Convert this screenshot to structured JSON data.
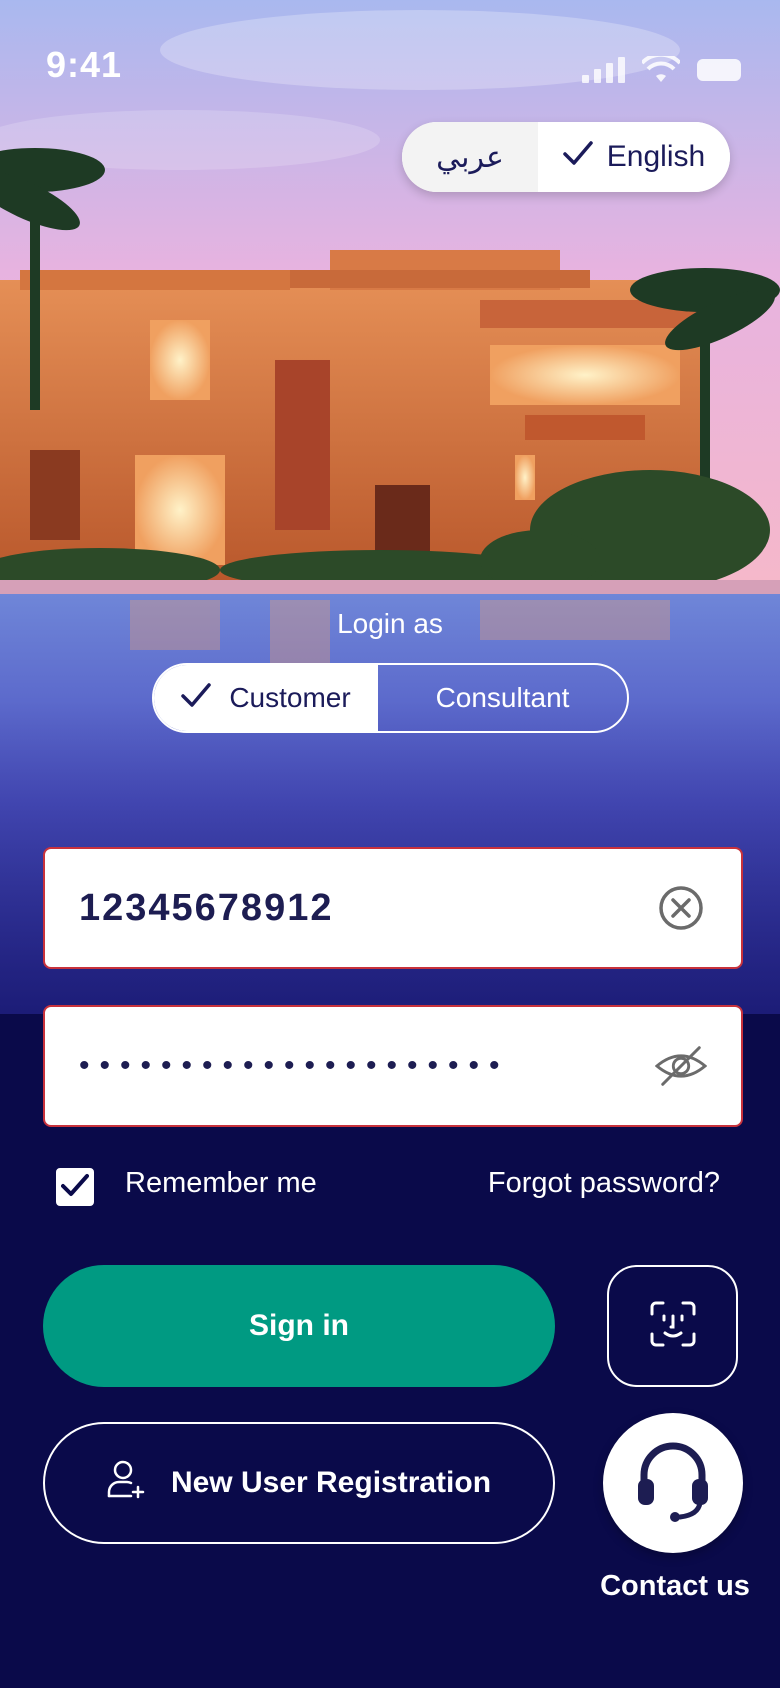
{
  "status_bar": {
    "time": "9:41"
  },
  "language": {
    "arabic_label": "عربي",
    "english_label": "English",
    "selected": "English"
  },
  "login_as": {
    "label": "Login as",
    "customer_label": "Customer",
    "consultant_label": "Consultant",
    "selected": "Customer"
  },
  "form": {
    "phone_value": "12345678912",
    "password_mask": "•••••••••••••••••••••",
    "remember_label": "Remember me",
    "remember_checked": true,
    "forgot_label": "Forgot password?"
  },
  "actions": {
    "signin_label": "Sign in",
    "register_label": "New User Registration",
    "contact_label": "Contact us"
  },
  "colors": {
    "primary_dark": "#0a0a4a",
    "accent_green": "#009a82",
    "field_border": "#c8323c",
    "text_dark": "#1d1d52"
  },
  "icons": {
    "checkmark": "check-icon",
    "clear": "clear-icon",
    "password_visibility": "eye-off-icon",
    "face_id": "face-id-icon",
    "add_user": "add-user-icon",
    "support": "headset-icon"
  }
}
